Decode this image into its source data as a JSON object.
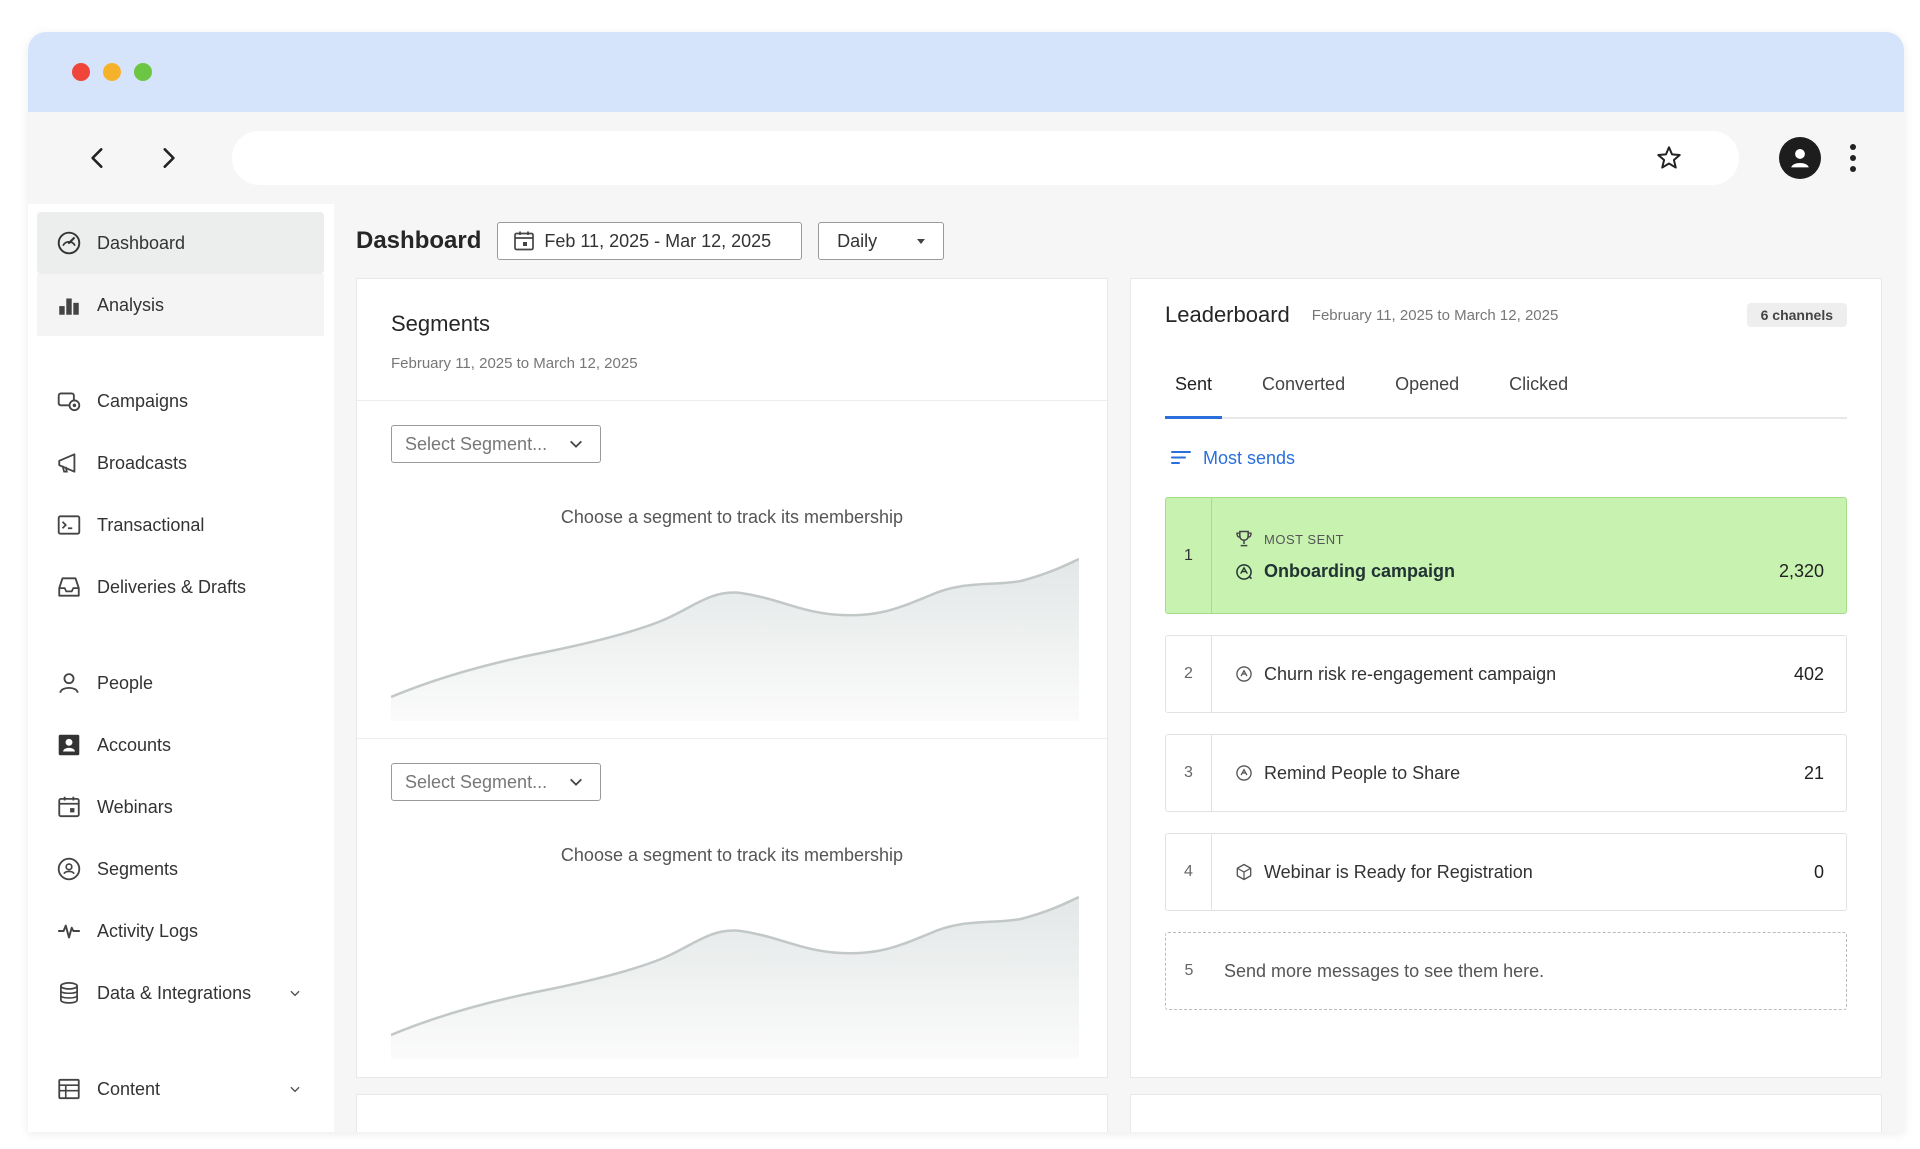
{
  "browser": {
    "icons": {
      "back": "chevron-left-icon",
      "forward": "chevron-right-icon",
      "bookmark": "star-icon",
      "profile": "user-avatar-icon",
      "menu": "kebab-menu-icon"
    }
  },
  "sidebar": {
    "primary": [
      {
        "label": "Dashboard",
        "icon": "gauge-icon",
        "active": true
      },
      {
        "label": "Analysis",
        "icon": "bar-chart-icon"
      }
    ],
    "messaging": [
      {
        "label": "Campaigns",
        "icon": "campaign-icon"
      },
      {
        "label": "Broadcasts",
        "icon": "megaphone-icon"
      },
      {
        "label": "Transactional",
        "icon": "terminal-icon"
      },
      {
        "label": "Deliveries & Drafts",
        "icon": "inbox-icon"
      }
    ],
    "data": [
      {
        "label": "People",
        "icon": "person-icon"
      },
      {
        "label": "Accounts",
        "icon": "contact-card-icon"
      },
      {
        "label": "Webinars",
        "icon": "calendar-icon"
      },
      {
        "label": "Segments",
        "icon": "segments-icon"
      },
      {
        "label": "Activity Logs",
        "icon": "pulse-icon"
      },
      {
        "label": "Data & Integrations",
        "icon": "database-icon",
        "expandable": true
      }
    ],
    "content": [
      {
        "label": "Content",
        "icon": "table-icon",
        "expandable": true
      }
    ]
  },
  "header": {
    "title": "Dashboard",
    "date_range": "Feb 11, 2025 - Mar 12, 2025",
    "period": "Daily"
  },
  "segments": {
    "title": "Segments",
    "subtitle": "February 11, 2025 to March 12, 2025",
    "blocks": [
      {
        "select_label": "Select Segment...",
        "message": "Choose a segment to track its membership"
      },
      {
        "select_label": "Select Segment...",
        "message": "Choose a segment to track its membership"
      }
    ]
  },
  "leaderboard": {
    "title": "Leaderboard",
    "subtitle": "February 11, 2025 to March 12, 2025",
    "badge": "6 channels",
    "tabs": [
      "Sent",
      "Converted",
      "Opened",
      "Clicked"
    ],
    "active_tab": "Sent",
    "sort_label": "Most sends",
    "top_label": "MOST SENT",
    "rows": [
      {
        "rank": "1",
        "name": "Onboarding campaign",
        "count": "2,320"
      },
      {
        "rank": "2",
        "name": "Churn risk re-engagement campaign",
        "count": "402"
      },
      {
        "rank": "3",
        "name": "Remind People to Share",
        "count": "21"
      },
      {
        "rank": "4",
        "name": "Webinar is Ready for Registration",
        "count": "0"
      }
    ],
    "empty_row": {
      "rank": "5",
      "message": "Send more messages to see them here."
    },
    "colors": {
      "highlight": "#c7f2b0",
      "accent": "#2a6fdb"
    }
  }
}
